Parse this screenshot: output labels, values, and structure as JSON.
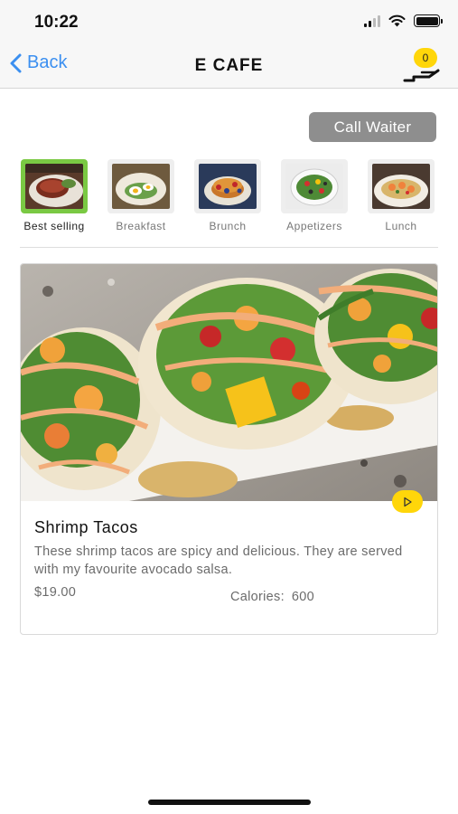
{
  "status_bar": {
    "time": "10:22"
  },
  "nav": {
    "back_label": "Back",
    "title": "E CAFE",
    "cart_badge": "0"
  },
  "call_waiter_label": "Call Waiter",
  "categories": [
    {
      "label": "Best selling",
      "active": true
    },
    {
      "label": "Breakfast",
      "active": false
    },
    {
      "label": "Brunch",
      "active": false
    },
    {
      "label": "Appetizers",
      "active": false
    },
    {
      "label": "Lunch",
      "active": false
    }
  ],
  "item": {
    "title": "Shrimp Tacos",
    "description": "These shrimp tacos are spicy and delicious. They are served with my favourite avocado salsa.",
    "price": "$19.00",
    "calories_label": "Calories:",
    "calories_value": "600"
  },
  "colors": {
    "accent_blue": "#3b8ff0",
    "active_green": "#7ac943",
    "badge_yellow": "#ffd60a",
    "button_gray": "#8e8e8e"
  },
  "icons": {
    "back": "chevron-left-icon",
    "waiter": "waiter-tray-icon",
    "play": "play-icon",
    "wifi": "wifi-icon",
    "signal": "signal-icon",
    "battery": "battery-icon"
  }
}
